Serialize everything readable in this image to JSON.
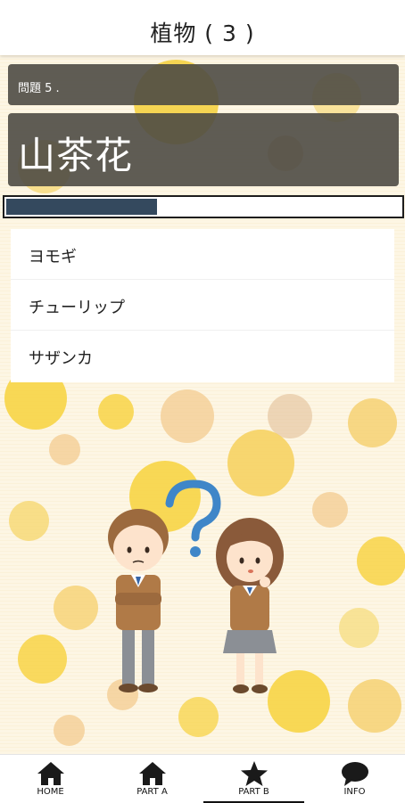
{
  "header": {
    "title": "植物 ( 3 )"
  },
  "question": {
    "number_label": "問題 5 .",
    "word": "山茶花",
    "timer_progress": 0.38
  },
  "choices": [
    {
      "label": "ヨモギ"
    },
    {
      "label": "チューリップ"
    },
    {
      "label": "サザンカ"
    }
  ],
  "tabs": [
    {
      "label": "HOME",
      "icon": "home-icon"
    },
    {
      "label": "PART A",
      "icon": "home-icon"
    },
    {
      "label": "PART B",
      "icon": "star-icon",
      "selected": true
    },
    {
      "label": "INFO",
      "icon": "chat-bubble-icon"
    }
  ],
  "colors": {
    "panel": "#4e4b44",
    "timer_fill": "#34495e",
    "dot_yellow": "#f7d23c",
    "dot_orange": "#f0b25a",
    "question_mark": "#3f86c8"
  }
}
